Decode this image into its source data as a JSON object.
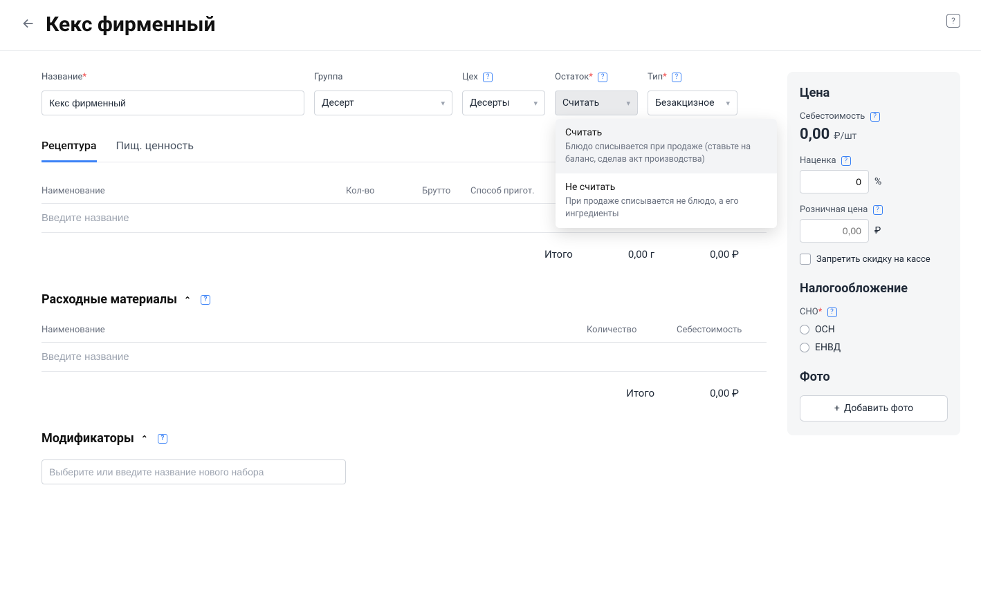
{
  "header": {
    "title": "Кекс фирменный"
  },
  "form": {
    "name": {
      "label": "Название",
      "value": "Кекс фирменный"
    },
    "group": {
      "label": "Группа",
      "value": "Десерт"
    },
    "shop": {
      "label": "Цех",
      "value": "Десерты"
    },
    "stock": {
      "label": "Остаток",
      "value": "Считать",
      "options": [
        {
          "title": "Считать",
          "desc": "Блюдо списывается при продаже (ставьте на баланс, сделав акт производства)"
        },
        {
          "title": "Не считать",
          "desc": "При продаже списывается не блюдо, а его ингредиенты"
        }
      ]
    },
    "type": {
      "label": "Тип",
      "value": "Безакцизное"
    }
  },
  "tabs": {
    "recipe": "Рецептура",
    "nutrition": "Пищ. ценность"
  },
  "recipe": {
    "headers": {
      "name": "Наименование",
      "qty": "Кол-во",
      "gross": "Брутто",
      "method": "Способ пригот."
    },
    "input_placeholder": "Введите название",
    "totals": {
      "label": "Итого",
      "weight": "0,00 г",
      "cost": "0,00 ₽"
    }
  },
  "consumables": {
    "title": "Расходные материалы",
    "headers": {
      "name": "Наименование",
      "qty": "Количество",
      "cost": "Себестоимость"
    },
    "input_placeholder": "Введите название",
    "totals": {
      "label": "Итого",
      "cost": "0,00 ₽"
    }
  },
  "modifiers": {
    "title": "Модификаторы",
    "placeholder": "Выберите или введите название нового набора"
  },
  "sidebar": {
    "price_h": "Цена",
    "cost_label": "Себестоимость",
    "cost_value": "0,00",
    "cost_unit": "₽/шт",
    "markup_label": "Наценка",
    "markup_value": "0",
    "markup_unit": "%",
    "retail_label": "Розничная цена",
    "retail_placeholder": "0,00",
    "retail_unit": "₽",
    "forbid_discount": "Запретить скидку на кассе",
    "tax_h": "Налогообложение",
    "sno_label": "СНО",
    "sno_options": [
      "ОСН",
      "ЕНВД"
    ],
    "photo_h": "Фото",
    "add_photo": "Добавить фото"
  }
}
